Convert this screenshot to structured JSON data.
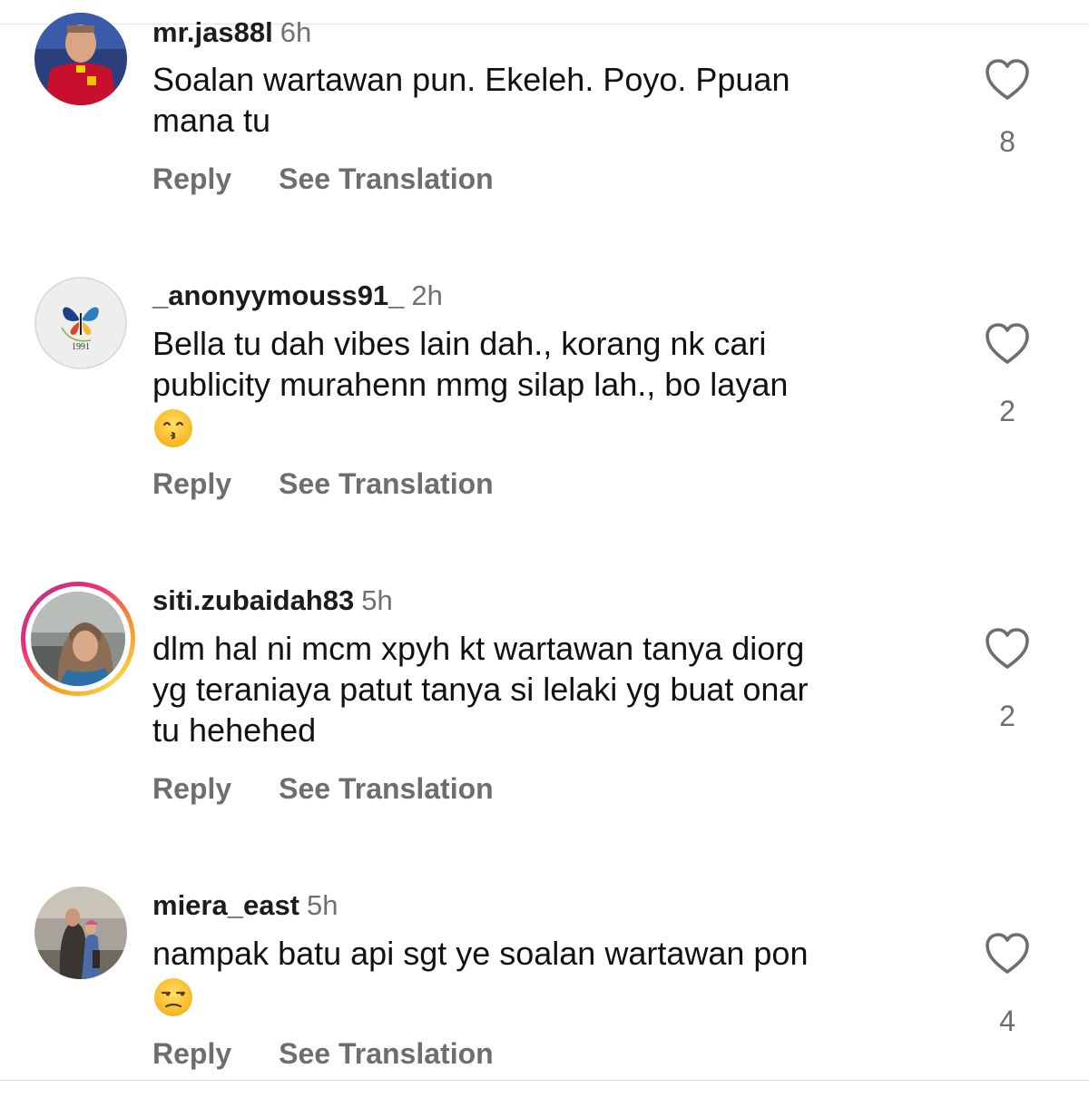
{
  "comments": [
    {
      "username": "mr.jas88l",
      "time": "6h",
      "text_lines": [
        "Soalan wartawan pun. Ekeleh. Poyo. Ppuan",
        "mana tu"
      ],
      "likes": "8",
      "reply_label": "Reply",
      "translate_label": "See Translation",
      "avatar": "man-in-red-jersey"
    },
    {
      "username": "_anonyymouss91_",
      "time": "2h",
      "text_lines": [
        "Bella tu dah vibes lain dah., korang nk cari",
        "publicity murahenn mmg silap lah., bo layan"
      ],
      "emoji": "kissing-face-with-smiling-eyes",
      "likes": "2",
      "reply_label": "Reply",
      "translate_label": "See Translation",
      "avatar": "butterfly-logo",
      "avatar_text": "1991"
    },
    {
      "username": "siti.zubaidah83",
      "time": "5h",
      "text_lines": [
        "dlm hal ni mcm xpyh kt wartawan tanya diorg",
        "yg teraniaya patut tanya si lelaki yg buat onar",
        "tu hehehed"
      ],
      "likes": "2",
      "reply_label": "Reply",
      "translate_label": "See Translation",
      "avatar": "woman-in-hijab",
      "has_story": true
    },
    {
      "username": "miera_east",
      "time": "5h",
      "text_lines": [
        "nampak batu api sgt ye soalan wartawan pon"
      ],
      "emoji": "unamused-face",
      "likes": "4",
      "reply_label": "Reply",
      "translate_label": "See Translation",
      "avatar": "family-outdoor-photo"
    }
  ],
  "icons": {
    "like": "heart-outline-icon"
  },
  "colors": {
    "text": "#111111",
    "secondary": "#6e6e6e",
    "story_ring_start": "#f9a024",
    "story_ring_end": "#ee2a7b"
  }
}
